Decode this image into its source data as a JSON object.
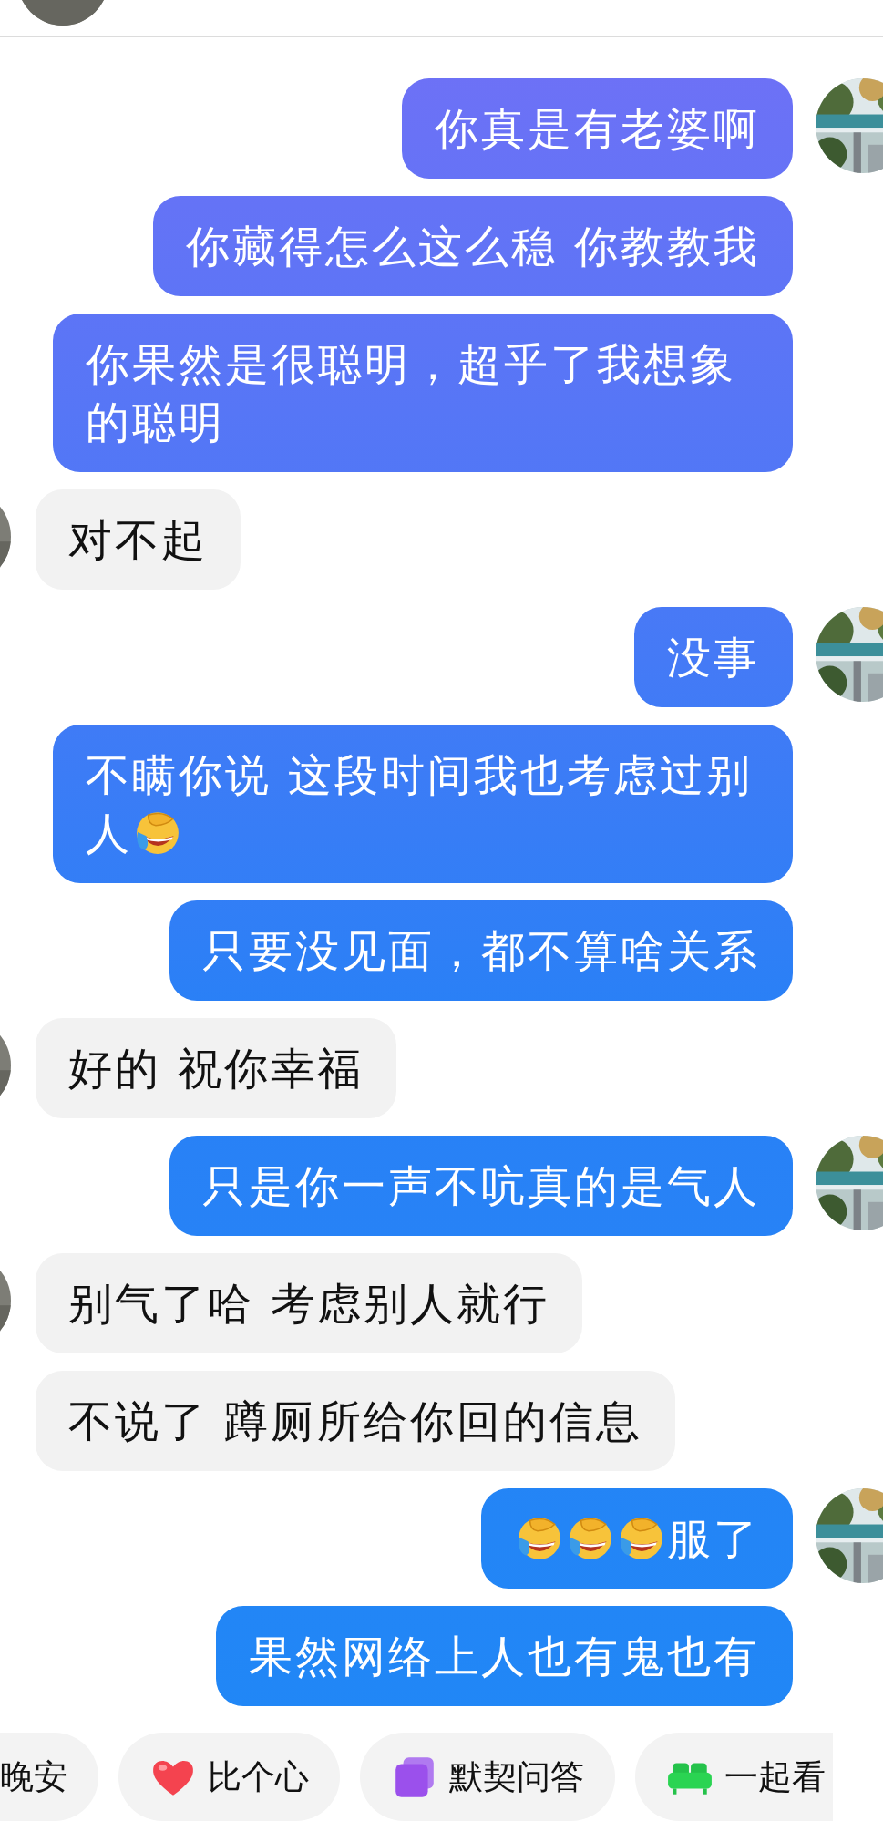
{
  "messages": [
    {
      "kind": "outgoing",
      "avatar": true,
      "segments": [
        {
          "kind": "text",
          "text": "你真是有老婆啊"
        }
      ]
    },
    {
      "kind": "outgoing",
      "avatar": false,
      "segments": [
        {
          "kind": "text",
          "text": "你藏得怎么这么稳 你教教我"
        }
      ]
    },
    {
      "kind": "outgoing",
      "avatar": false,
      "segments": [
        {
          "kind": "text",
          "text": "你果然是很聪明，超乎了我想象的聪明"
        }
      ]
    },
    {
      "kind": "incoming",
      "avatar": true,
      "segments": [
        {
          "kind": "text",
          "text": "对不起"
        }
      ]
    },
    {
      "kind": "outgoing",
      "avatar": true,
      "segments": [
        {
          "kind": "text",
          "text": "没事"
        }
      ]
    },
    {
      "kind": "outgoing",
      "avatar": false,
      "segments": [
        {
          "kind": "text",
          "text": "不瞒你说 这段时间我也考虑过别"
        },
        {
          "kind": "text",
          "text": "人"
        },
        {
          "kind": "emoji"
        }
      ]
    },
    {
      "kind": "outgoing",
      "avatar": false,
      "segments": [
        {
          "kind": "text",
          "text": "只要没见面，都不算啥关系"
        }
      ]
    },
    {
      "kind": "incoming",
      "avatar": true,
      "segments": [
        {
          "kind": "text",
          "text": "好的 祝你幸福"
        }
      ]
    },
    {
      "kind": "outgoing",
      "avatar": true,
      "segments": [
        {
          "kind": "text",
          "text": "只是你一声不吭真的是气人"
        }
      ]
    },
    {
      "kind": "incoming",
      "avatar": true,
      "segments": [
        {
          "kind": "text",
          "text": "别气了哈 考虑别人就行"
        }
      ]
    },
    {
      "kind": "incoming",
      "avatar": false,
      "segments": [
        {
          "kind": "text",
          "text": "不说了 蹲厕所给你回的信息"
        }
      ]
    },
    {
      "kind": "outgoing",
      "avatar": true,
      "segments": [
        {
          "kind": "emoji"
        },
        {
          "kind": "emoji"
        },
        {
          "kind": "emoji"
        },
        {
          "kind": "text",
          "text": "服了"
        }
      ]
    },
    {
      "kind": "outgoing",
      "avatar": false,
      "segments": [
        {
          "kind": "text",
          "text": "果然网络上人也有鬼也有"
        }
      ]
    }
  ],
  "quick_replies": [
    {
      "kind": "plain",
      "label": "晚安"
    },
    {
      "kind": "heart",
      "label": "比个心"
    },
    {
      "kind": "quiz",
      "label": "默契问答"
    },
    {
      "kind": "sofa",
      "label": "一起看"
    }
  ]
}
